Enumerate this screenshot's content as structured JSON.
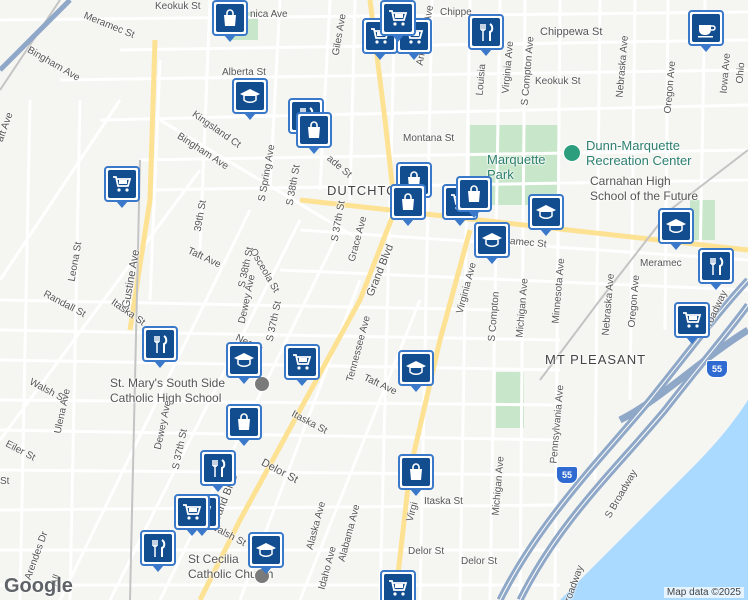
{
  "map": {
    "neighborhoods": {
      "dutchtown": "DUTCHTO",
      "mt_pleasant": "MT PLEASANT"
    },
    "parks": {
      "marquette_park": "Marquette\nPark",
      "dunn_marquette": "Dunn-Marquette\nRecreation Center"
    },
    "schools": {
      "carnahan": "Carnahan High\nSchool of the Future",
      "st_marys": "St. Mary's South Side\nCatholic High School",
      "st_cecilia": "St Cecilia\nCatholic Church"
    },
    "streets": {
      "keokuk_1": "Keokuk St",
      "minnica": "nica Ave",
      "chippewa": "Chippewa St",
      "chippewa_2": "Chippe",
      "meramec_1": "Meramec St",
      "meramec_2": "amec St",
      "meramec_3": "Meramec",
      "bingham_1": "Bingham Ave",
      "bingham_2": "Bingham Ave",
      "alberta": "Alberta St",
      "keokuk_2": "Keokuk St",
      "kingsland": "Kingsland Ct",
      "montana": "Montana St",
      "giles": "Giles Ave",
      "arkansas": "Arkansas Ave",
      "louisiana": "Louisia",
      "virginia_1": "Virginia Ave",
      "virginia_2": "Virginia Ave",
      "virginia_3": "Virgi",
      "s_compton_1": "S Compton Ave",
      "s_compton_2": "S Compton",
      "nebraska_1": "Nebraska Ave",
      "nebraska_2": "Nebraska Ave",
      "oregon_1": "Oregon Ave",
      "oregon_2": "Oregon Ave",
      "iowa": "Iowa Ave",
      "ohio": "Ohio",
      "s_spring": "S Spring Ave",
      "s_38th_1": "S 38th St",
      "s_38th_2": "S 38th St",
      "s_37th_1": "S 37th St",
      "s_37th_2": "S 37th St",
      "s_37th_3": "S 37th St",
      "osceola": "Osceola St",
      "grace": "Grace Ave",
      "grand_1": "Grand Blvd",
      "grand_2": "Grand Blvd",
      "39th": "39th St",
      "taft_1": "Taft Ave",
      "taft_2": "Taft Ave",
      "dewey_1": "Dewey Ave",
      "dewey_2": "Dewey Ave",
      "leona": "Leona St",
      "gustine": "Gustine Ave",
      "randall": "Randall St",
      "itaska_1": "Itaska St",
      "itaska_2": "Itaska St",
      "itaska_3": "Itaska St",
      "neosho": "Neosh",
      "tennessee": "Tennessee Ave",
      "michigan_1": "Michigan Ave",
      "michigan_2": "Michigan Ave",
      "minnesota": "Minnesota Ave",
      "pennsylvania": "Pennsylvania Ave",
      "s_broadway_1": "S Broadway",
      "s_broadway_2": "Broadway",
      "s_broadway_3": "roadway",
      "walsh_1": "Walsh St",
      "walsh_2": "Walsh St",
      "ulena": "Ulena Ave",
      "eiler": "Eiler St",
      "delor_1": "Delor St",
      "delor_2": "Delor St",
      "delor_3": "Delor St",
      "alaska": "Alaska Ave",
      "idaho": "Idaho Ave",
      "alabama": "Alabama Ave",
      "arendes": "Arendes Dr",
      "all": "All",
      "wade": "ade St",
      "aft": "aft Ave",
      "st": "St",
      "ade_2": "ade"
    },
    "shields": {
      "i55_1": "55",
      "i55_2": "55"
    },
    "attribution": "Map data ©2025",
    "logo": "Google",
    "colors": {
      "pin_border": "#3a78c9",
      "pin_fill": "#124e8f",
      "water": "#aadaff",
      "park": "#c8e6c9",
      "highway": "#8fa8c8"
    },
    "pins": [
      {
        "name": "shopping-pin",
        "icon": "bag"
      },
      {
        "name": "grocery-pin",
        "icon": "cart"
      },
      {
        "name": "grocery-pin",
        "icon": "cart"
      },
      {
        "name": "grocery-pin",
        "icon": "cart"
      },
      {
        "name": "restaurant-pin",
        "icon": "fork"
      },
      {
        "name": "cafe-pin",
        "icon": "cup"
      },
      {
        "name": "school-pin",
        "icon": "cap"
      },
      {
        "name": "restaurant-pin",
        "icon": "fork"
      },
      {
        "name": "shopping-pin",
        "icon": "bag"
      },
      {
        "name": "grocery-pin",
        "icon": "cart"
      },
      {
        "name": "shopping-pin",
        "icon": "bag"
      },
      {
        "name": "shopping-pin",
        "icon": "bag"
      },
      {
        "name": "grocery-pin",
        "icon": "cart"
      },
      {
        "name": "shopping-pin",
        "icon": "bag"
      },
      {
        "name": "school-pin",
        "icon": "cap"
      },
      {
        "name": "school-pin",
        "icon": "cap"
      },
      {
        "name": "school-pin",
        "icon": "cap"
      },
      {
        "name": "restaurant-pin",
        "icon": "fork"
      },
      {
        "name": "grocery-pin",
        "icon": "cart"
      },
      {
        "name": "restaurant-pin",
        "icon": "fork"
      },
      {
        "name": "school-pin",
        "icon": "cap"
      },
      {
        "name": "grocery-pin",
        "icon": "cart"
      },
      {
        "name": "school-pin",
        "icon": "cap"
      },
      {
        "name": "shopping-pin",
        "icon": "bag"
      },
      {
        "name": "restaurant-pin",
        "icon": "fork"
      },
      {
        "name": "shopping-pin",
        "icon": "bag"
      },
      {
        "name": "grocery-pin",
        "icon": "cart"
      },
      {
        "name": "grocery-pin",
        "icon": "cart"
      },
      {
        "name": "restaurant-pin",
        "icon": "fork"
      },
      {
        "name": "school-pin",
        "icon": "cap"
      },
      {
        "name": "grocery-pin",
        "icon": "cart"
      }
    ]
  }
}
